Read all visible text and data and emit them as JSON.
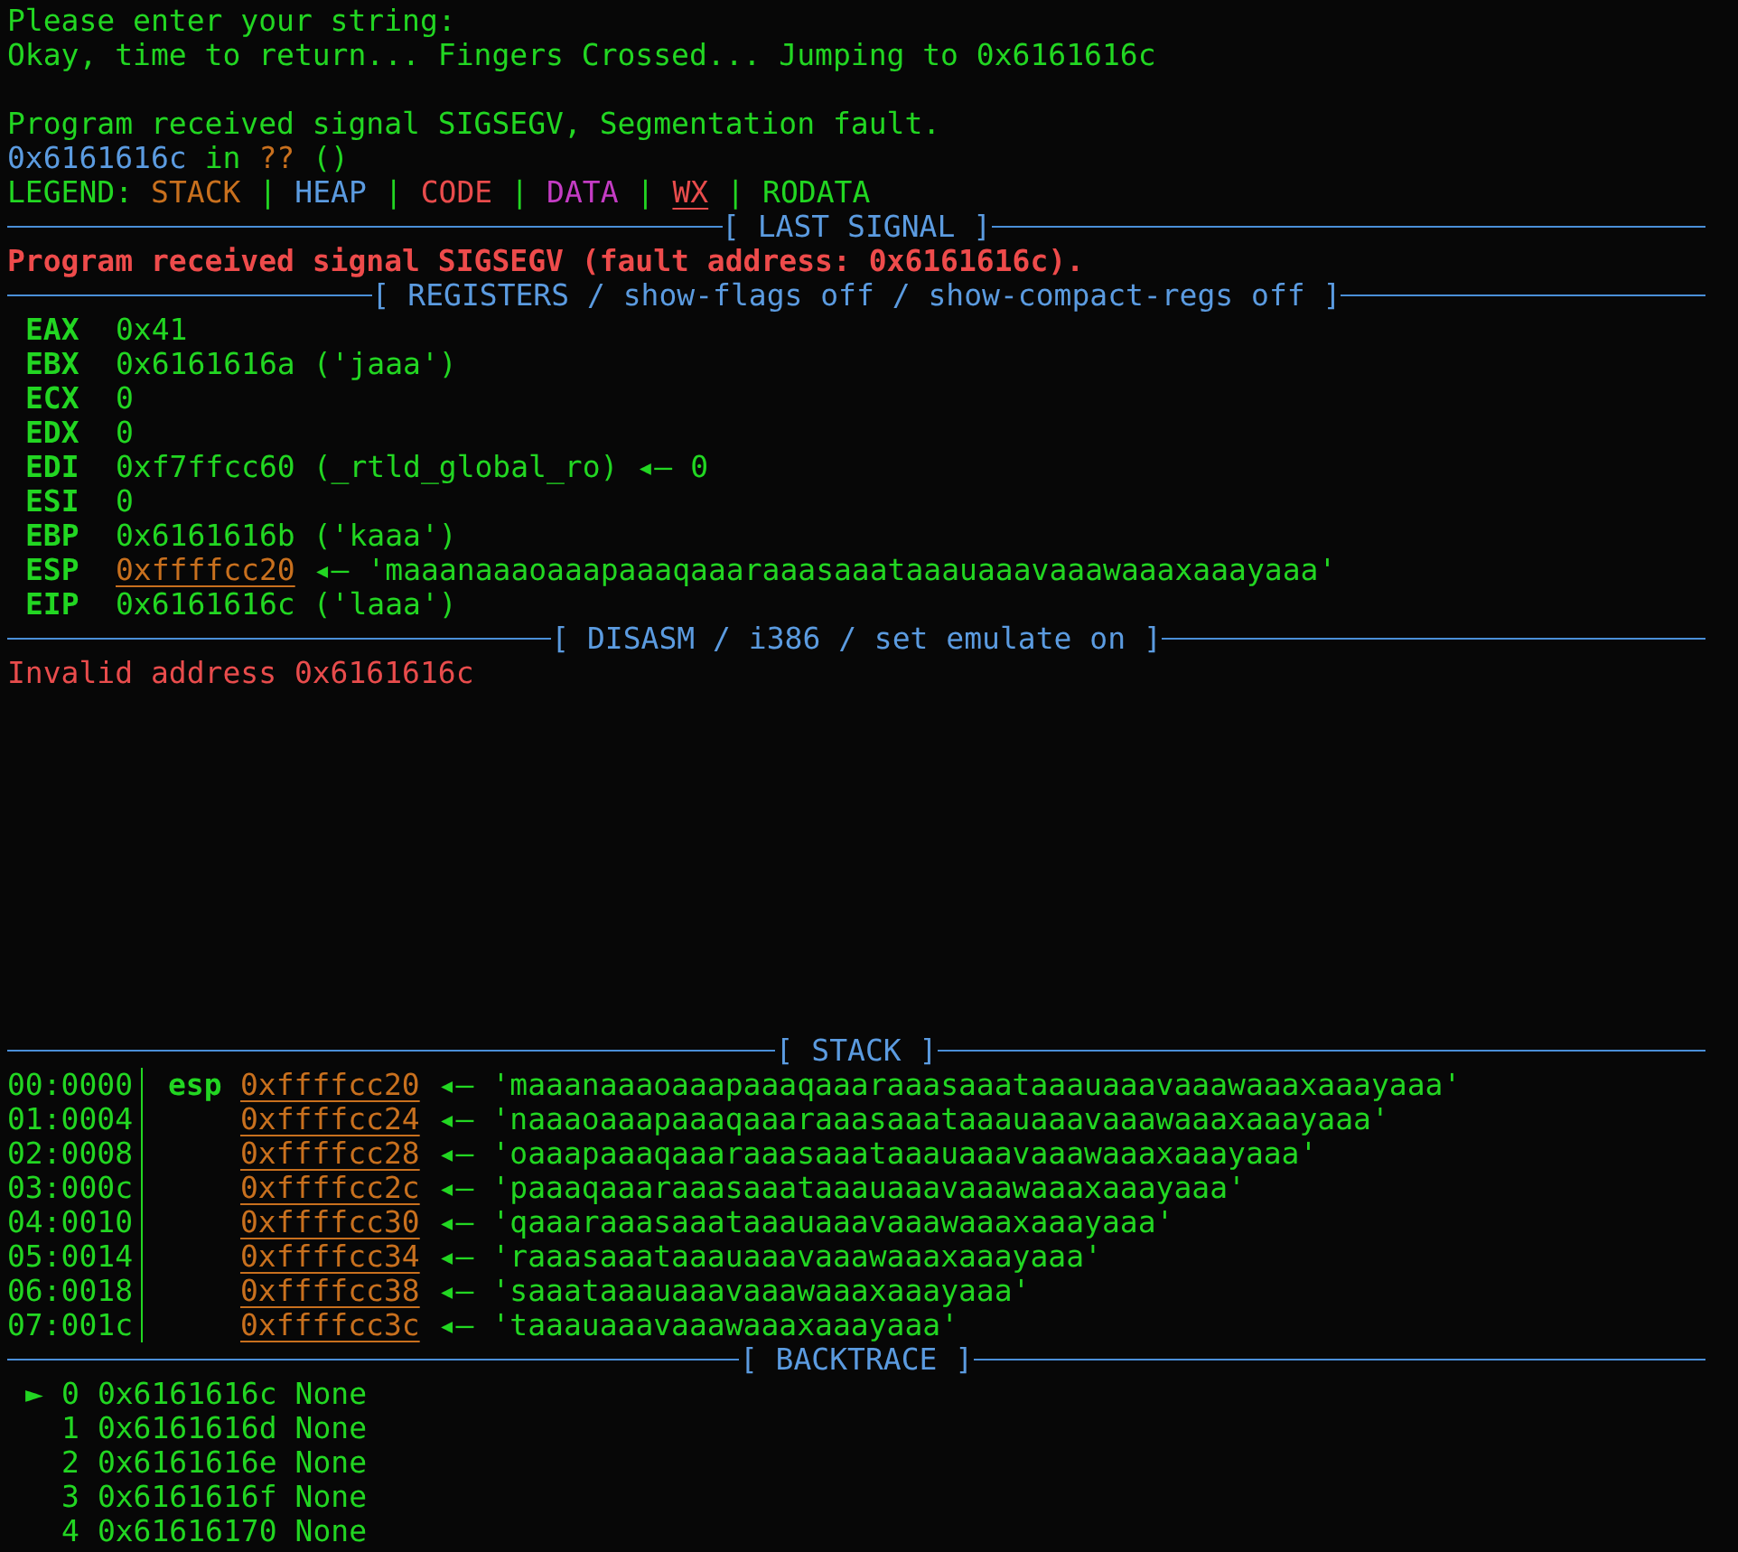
{
  "terminal": {
    "preamble": [
      {
        "text": "Please enter your string:"
      },
      {
        "text": "Okay, time to return... Fingers Crossed... Jumping to 0x6161616c"
      }
    ],
    "signal_message": "Program received signal SIGSEGV, Segmentation fault.",
    "location": {
      "address": "0x6161616c",
      "word": "in",
      "symbol": "??",
      "args": "()"
    },
    "legend": {
      "label": "LEGEND:",
      "separators": [
        "|",
        "|",
        "|",
        "|",
        "|"
      ],
      "items": [
        {
          "text": "STACK",
          "color": "#c8701e",
          "underlined": false
        },
        {
          "text": "HEAP",
          "color": "#5b9be0",
          "underlined": false
        },
        {
          "text": "CODE",
          "color": "#e84c4c",
          "underlined": false
        },
        {
          "text": "DATA",
          "color": "#c43cc4",
          "underlined": false
        },
        {
          "text": "WX",
          "color": "#e84c4c",
          "underlined": true
        },
        {
          "text": "RODATA",
          "color": "#22d622",
          "underlined": false
        }
      ]
    },
    "last_signal": {
      "header": "[ LAST SIGNAL ]",
      "message": "Program received signal SIGSEGV (fault address: 0x6161616c)."
    },
    "registers": {
      "header": "[ REGISTERS / show-flags off / show-compact-regs off ]",
      "rows": [
        {
          "name": "EAX",
          "value": "0x41",
          "kind": "plain"
        },
        {
          "name": "EBX",
          "value": "0x6161616a",
          "kind": "plain",
          "detail": "('jaaa')"
        },
        {
          "name": "ECX",
          "value": "0",
          "kind": "plain"
        },
        {
          "name": "EDX",
          "value": "0",
          "kind": "plain"
        },
        {
          "name": "EDI",
          "value": "0xf7ffcc60",
          "kind": "plain",
          "detail": "(_rtld_global_ro)",
          "arrow": "◂—",
          "target": "0"
        },
        {
          "name": "ESI",
          "value": "0",
          "kind": "plain"
        },
        {
          "name": "EBP",
          "value": "0x6161616b",
          "kind": "plain",
          "detail": "('kaaa')"
        },
        {
          "name": "ESP",
          "value": "0xffffcc20",
          "kind": "stack",
          "arrow": "◂—",
          "target": "'maaanaaaoaaapaaaqaaaraaasaaataaauaaavaaawaaaxaaayaaa'"
        },
        {
          "name": "EIP",
          "value": "0x6161616c",
          "kind": "plain",
          "detail": "('laaa')"
        }
      ]
    },
    "disasm": {
      "header": "[ DISASM / i386 / set emulate on ]",
      "message": "Invalid address 0x6161616c"
    },
    "stack": {
      "header": "[ STACK ]",
      "rows": [
        {
          "offset": "00:0000",
          "register": "esp",
          "address": "0xffffcc20",
          "arrow": "◂—",
          "value": "'maaanaaaoaaapaaaqaaaraaasaaataaauaaavaaawaaaxaaayaaa'"
        },
        {
          "offset": "01:0004",
          "address": "0xffffcc24",
          "arrow": "◂—",
          "value": "'naaaoaaapaaaqaaaraaasaaataaauaaavaaawaaaxaaayaaa'"
        },
        {
          "offset": "02:0008",
          "address": "0xffffcc28",
          "arrow": "◂—",
          "value": "'oaaapaaaqaaaraaasaaataaauaaavaaawaaaxaaayaaa'"
        },
        {
          "offset": "03:000c",
          "address": "0xffffcc2c",
          "arrow": "◂—",
          "value": "'paaaqaaaraaasaaataaauaaavaaawaaaxaaayaaa'"
        },
        {
          "offset": "04:0010",
          "address": "0xffffcc30",
          "arrow": "◂—",
          "value": "'qaaaraaasaaataaauaaavaaawaaaxaaayaaa'"
        },
        {
          "offset": "05:0014",
          "address": "0xffffcc34",
          "arrow": "◂—",
          "value": "'raaasaaataaauaaavaaawaaaxaaayaaa'"
        },
        {
          "offset": "06:0018",
          "address": "0xffffcc38",
          "arrow": "◂—",
          "value": "'saaataaauaaavaaawaaaxaaayaaa'"
        },
        {
          "offset": "07:001c",
          "address": "0xffffcc3c",
          "arrow": "◂—",
          "value": "'taaauaaavaaawaaaxaaayaaa'"
        }
      ]
    },
    "backtrace": {
      "header": "[ BACKTRACE ]",
      "frames": [
        {
          "marker": "►",
          "number": "0",
          "address": "0x6161616c",
          "symbol": "None"
        },
        {
          "number": "1",
          "address": "0x6161616d",
          "symbol": "None"
        },
        {
          "number": "2",
          "address": "0x6161616e",
          "symbol": "None"
        },
        {
          "number": "3",
          "address": "0x6161616f",
          "symbol": "None"
        },
        {
          "number": "4",
          "address": "0x61616170",
          "symbol": "None"
        }
      ]
    }
  }
}
